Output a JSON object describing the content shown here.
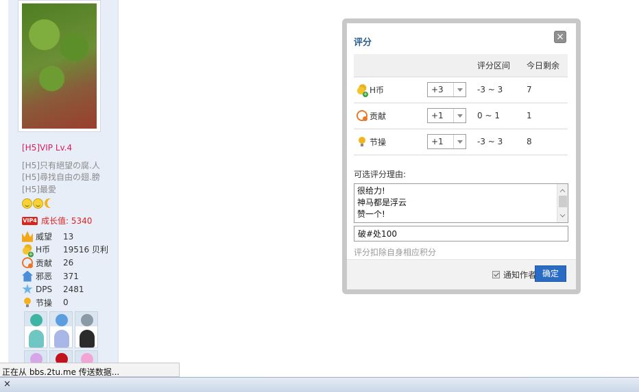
{
  "user_panel": {
    "vip_level": "[H5]VIP Lv.4",
    "taglines": [
      "[H5]只有絕望の腐.人",
      "[H5]尋找自由の翅.膀",
      "[H5]最愛"
    ],
    "vip_badge": "VIP4",
    "growth": "成长值: 5340",
    "stats": [
      {
        "icon": "crown-icon",
        "label": "威望",
        "value": "13"
      },
      {
        "icon": "coin-icon",
        "label": "H币",
        "value": "19516 贝利"
      },
      {
        "icon": "heart-icon",
        "label": "贡献",
        "value": "26"
      },
      {
        "icon": "house-icon",
        "label": "邪恶",
        "value": "371"
      },
      {
        "icon": "star-icon",
        "label": "DPS",
        "value": "2481"
      },
      {
        "icon": "bulb-icon",
        "label": "节操",
        "value": "0"
      }
    ]
  },
  "status_bar": {
    "text": "正在从 bbs.2tu.me 传送数据..."
  },
  "bottom_bar": {
    "close_glyph": "×"
  },
  "dialog": {
    "title": "评分",
    "close_glyph": "×",
    "headers": {
      "name": "",
      "select": "",
      "range": "评分区间",
      "remaining": "今日剩余"
    },
    "rows": [
      {
        "icon": "coin-icon",
        "name": "H币",
        "selected": "+3",
        "range": "-3 ~ 3",
        "remaining": "7"
      },
      {
        "icon": "heart-icon",
        "name": "贡献",
        "selected": "+1",
        "range": "0 ~ 1",
        "remaining": "1"
      },
      {
        "icon": "bulb-icon",
        "name": "节操",
        "selected": "+1",
        "range": "-3 ~ 3",
        "remaining": "8"
      }
    ],
    "reason_label": "可选评分理由:",
    "reasons": [
      "很给力!",
      "神马都是浮云",
      "赞一个!"
    ],
    "reason_input_value": "破#处100",
    "deduct_note": "评分扣除自身相应积分",
    "notify_label": "通知作者",
    "notify_checked": true,
    "confirm_label": "确定"
  }
}
